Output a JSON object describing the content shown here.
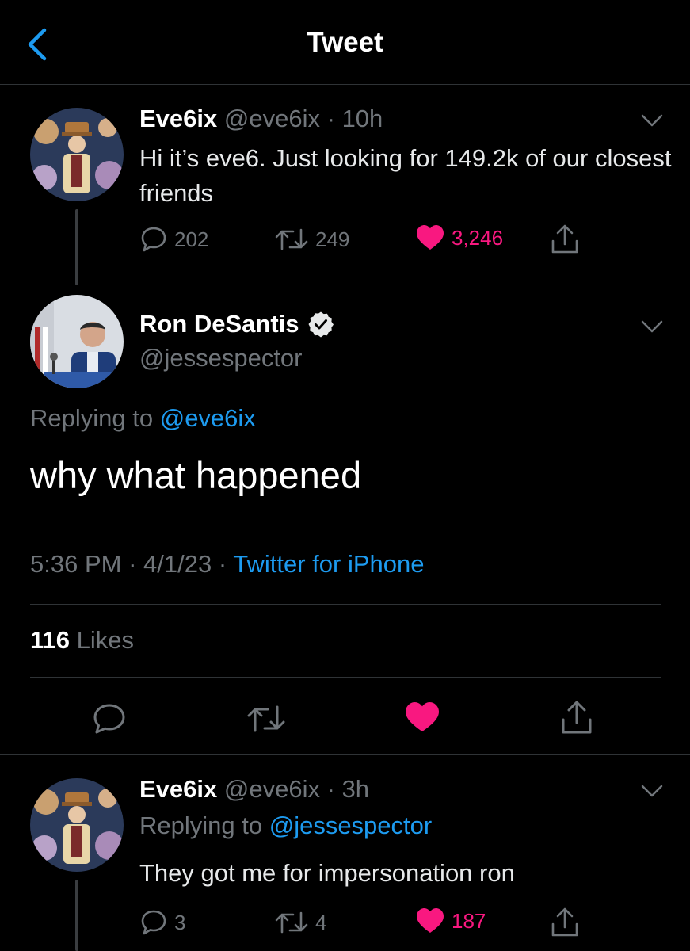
{
  "header": {
    "title": "Tweet",
    "back_icon": "chevron-left-icon",
    "accent_color": "#1d9bf0"
  },
  "parent_tweet": {
    "display_name": "Eve6ix",
    "handle": "@eve6ix",
    "separator": "·",
    "time": "10h",
    "text": "Hi it’s eve6. Just looking for 149.2k of our closest friends",
    "replies": "202",
    "retweets": "249",
    "likes": "3,246",
    "liked": true
  },
  "main_tweet": {
    "display_name": "Ron DeSantis",
    "verified_icon": "verified-badge-icon",
    "handle": "@jessespector",
    "replying_prefix": "Replying to",
    "replying_to": "@eve6ix",
    "text": "why what happened",
    "time": "5:36 PM",
    "date": "4/1/23",
    "separator": "·",
    "source": "Twitter for iPhone",
    "like_count": "116",
    "like_label": "Likes",
    "like_color": "#f91880"
  },
  "reply_tweet": {
    "display_name": "Eve6ix",
    "handle": "@eve6ix",
    "separator": "·",
    "time": "3h",
    "replying_prefix": "Replying to",
    "replying_to": "@jessespector",
    "text": "They got me for impersonation ron",
    "replies": "3",
    "retweets": "4",
    "likes": "187",
    "liked": true
  }
}
